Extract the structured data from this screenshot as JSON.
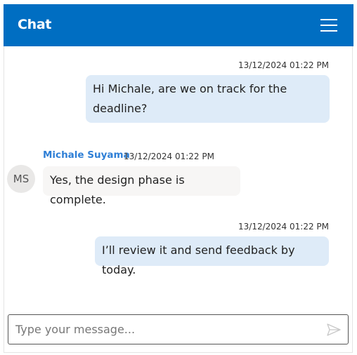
{
  "header": {
    "title": "Chat",
    "menu_icon": "hamburger-icon"
  },
  "messages": [
    {
      "direction": "outgoing",
      "timestamp": "13/12/2024 01:22 PM",
      "lines": [
        "Hi Michale, are we on track for the",
        "deadline?"
      ]
    },
    {
      "direction": "incoming",
      "author": "Michale Suyama",
      "initials": "MS",
      "timestamp": "13/12/2024 01:22 PM",
      "text": "Yes, the design phase is complete."
    },
    {
      "direction": "outgoing",
      "timestamp": "13/12/2024 01:22 PM",
      "text": "I’ll review it and send feedback by today."
    }
  ],
  "composer": {
    "placeholder": "Type your message...",
    "value": "",
    "send_icon": "send-icon"
  },
  "colors": {
    "header": "#006ec2",
    "outgoing_bubble": "#deebf8",
    "incoming_bubble": "#f7f6f5",
    "author": "#2f7fd6"
  }
}
